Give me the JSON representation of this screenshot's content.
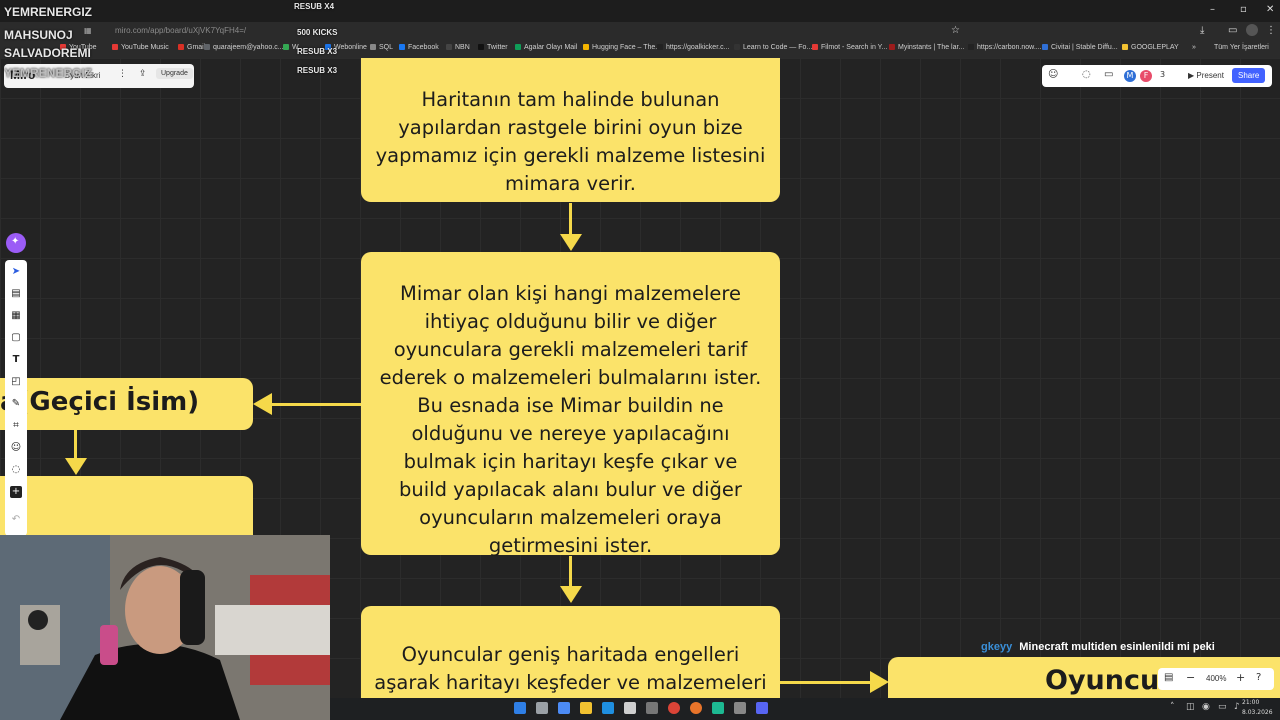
{
  "browser": {
    "url": "miro.com/app/board/uXjVK7YqFH4=/",
    "tab_labels": [
      "RESUB X4",
      "500 KICKS",
      "RESUB X3",
      "RESUB X3"
    ],
    "bookmarks": [
      "YouTube",
      "YouTube Music",
      "Gmail",
      "quarajeem@yahoo.c...",
      "W",
      "Webonline",
      "SQL",
      "Facebook",
      "NBN",
      "Twitter",
      "Agalar Olayı Mail",
      "Hugging Face – The...",
      "https://goalkicker.c...",
      "Learn to Code — Fo...",
      "Filmot - Search in Y...",
      "Myinstants | The lar...",
      "https://carbon.now....",
      "Civitai | Stable Diffu...",
      "GOOGLEPLAY"
    ],
    "all_bookmarks_label": "Tüm Yer İşaretleri",
    "more_bookmarks": "»"
  },
  "overlay": {
    "names": [
      "YEMRENERGIZ",
      "MAHSUNOJ",
      "SALVADOREMI",
      "YEMRENERGIZ"
    ]
  },
  "board": {
    "title": "Miro",
    "board_name": "Oyun Fikri",
    "upgrade_label": "Upgrade"
  },
  "collab": {
    "avatar_letters": [
      "M",
      "F"
    ],
    "participant_count": "3",
    "present_label": "Present",
    "share_label": "Share"
  },
  "cards": {
    "top": "Haritanın tam halinde bulunan yapılardan rastgele birini oyun bize yapmamız için gerekli malzeme listesini mimara verir.",
    "middle": "Mimar olan kişi hangi malzemelere ihtiyaç olduğunu bilir ve diğer oyunculara gerekli malzemeleri tarif ederek o malzemeleri bulmalarını ister. Bu esnada ise Mimar buildin ne olduğunu ve nereye yapılacağını bulmak için haritayı keşfe çıkar ve build yapılacak alanı bulur ve diğer oyuncuların malzemeleri oraya getirmesini ister.",
    "bottom": "Oyuncular geniş haritada engelleri aşarak haritayı keşfeder ve malzemeleri fiziksel",
    "left": "a(Geçici İsim)",
    "right": "Oyuncu"
  },
  "chat": {
    "user": "gkeyy",
    "message": "Minecraft multiden esinlenildi mi peki",
    "user_color": "#3a8fd8"
  },
  "zoom": {
    "level": "400%"
  },
  "taskbar": {
    "time": "21:00",
    "date": "8.03.2026"
  },
  "colors": {
    "card": "#fbe36a",
    "share": "#4262ff",
    "magic": "#9b5cf6"
  }
}
